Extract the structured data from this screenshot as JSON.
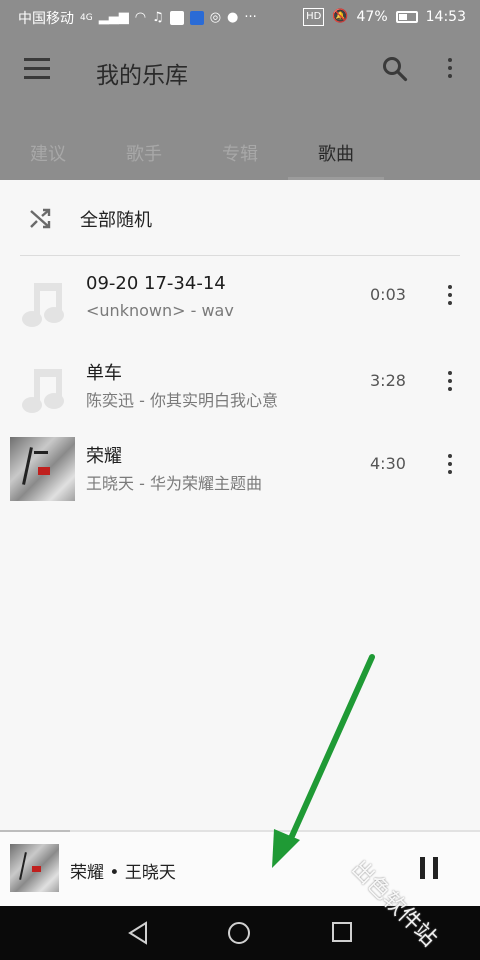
{
  "statusbar": {
    "carrier": "中国移动",
    "network": "4G",
    "battery": "47%",
    "time": "14:53"
  },
  "appbar": {
    "title": "我的乐库",
    "icons": {
      "menu": "menu-icon",
      "search": "search-icon",
      "more": "more-vert-icon"
    }
  },
  "tabs": [
    {
      "label": "建议",
      "active": false
    },
    {
      "label": "歌手",
      "active": false
    },
    {
      "label": "专辑",
      "active": false
    },
    {
      "label": "歌曲",
      "active": true
    }
  ],
  "shuffle": {
    "label": "全部随机",
    "icon": "shuffle-icon"
  },
  "songs": [
    {
      "title": "09-20 17-34-14",
      "subtitle": "<unknown> - wav",
      "duration": "0:03",
      "art": "music-note-icon"
    },
    {
      "title": "单车",
      "subtitle": "陈奕迅 - 你其实明白我心意",
      "duration": "3:28",
      "art": "music-note-icon"
    },
    {
      "title": "荣耀",
      "subtitle": "王晓天 - 华为荣耀主题曲",
      "duration": "4:30",
      "art": "album-cover"
    }
  ],
  "player": {
    "now_playing": "荣耀 • 王晓天",
    "state": "playing",
    "icon": "pause-icon"
  },
  "watermark": "出色软件站",
  "colors": {
    "appbar": "#8d8d8d",
    "annotation_arrow": "#1f9a35"
  }
}
